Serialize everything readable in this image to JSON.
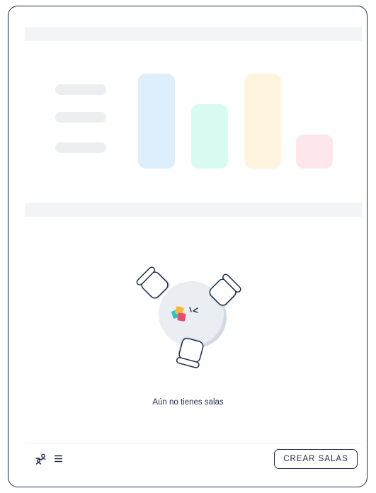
{
  "empty_state": {
    "message": "Aún no tienes salas"
  },
  "footer": {
    "people_icon": "people-icon",
    "menu_icon": "menu-icon",
    "create_button_label": "CREAR SALAS"
  },
  "colors": {
    "border": "#1e2a47",
    "skeleton": "#f2f4f8",
    "skeleton_line": "#eceef2",
    "placeholder_blue": "#ddeefc",
    "placeholder_mint": "#d8fbf3",
    "placeholder_cream": "#fff4dd",
    "placeholder_pink": "#fde7eb"
  }
}
